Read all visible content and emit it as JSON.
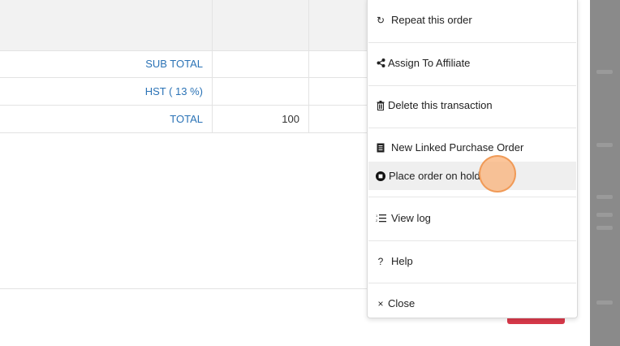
{
  "totals": {
    "rows": [
      {
        "label": "SUB TOTAL",
        "value": ""
      },
      {
        "label": "HST ( 13 %)",
        "value": ""
      },
      {
        "label": "TOTAL",
        "value": "100"
      }
    ]
  },
  "menu": {
    "items": [
      {
        "label": "Repeat this order",
        "icon": "repeat-icon",
        "glyph": "↻"
      },
      {
        "label": "Assign To Affiliate",
        "icon": "share-icon",
        "glyph": "<"
      },
      {
        "label": "Delete this transaction",
        "icon": "trash-icon",
        "glyph": "🗑"
      },
      {
        "label": "New Linked Purchase Order",
        "icon": "document-icon",
        "glyph": "▤"
      },
      {
        "label": "Place order on hold",
        "icon": "stop-circle-icon",
        "glyph": "●"
      },
      {
        "label": "View log",
        "icon": "list-icon",
        "glyph": "≡"
      },
      {
        "label": "Help",
        "icon": "question-icon",
        "glyph": "?"
      },
      {
        "label": "Close",
        "icon": "close-icon",
        "glyph": "×"
      }
    ]
  },
  "colors": {
    "link_blue": "#2b73b6",
    "accent_red": "#d8394a",
    "hover_gray": "#efefef",
    "cursor_orange": "#f9b278"
  }
}
